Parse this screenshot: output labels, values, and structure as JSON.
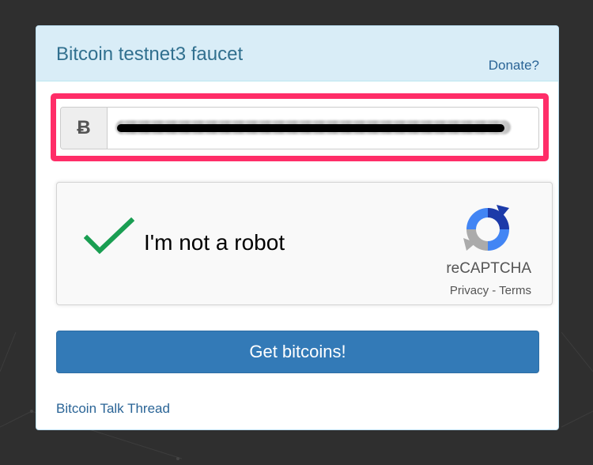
{
  "page": {
    "background_color": "#2f2f2f"
  },
  "header": {
    "title": "Bitcoin testnet3 faucet",
    "donate_label": "Donate?"
  },
  "address_input": {
    "prefix_symbol": "Ƀ",
    "value": "",
    "redacted": true
  },
  "captcha": {
    "checked": true,
    "label": "I'm not a robot",
    "brand": "reCAPTCHA",
    "privacy_label": "Privacy",
    "separator": " - ",
    "terms_label": "Terms"
  },
  "submit": {
    "label": "Get bitcoins!"
  },
  "footer": {
    "thread_link_label": "Bitcoin Talk Thread"
  },
  "colors": {
    "highlight": "#ff2d68",
    "primary_button": "#337ab7",
    "heading_bg": "#d9edf7",
    "check_green": "#1a9e52"
  },
  "icons": {
    "currency": "bitcoin-icon",
    "check": "checkmark-icon",
    "captcha_logo": "recaptcha-logo-icon"
  }
}
